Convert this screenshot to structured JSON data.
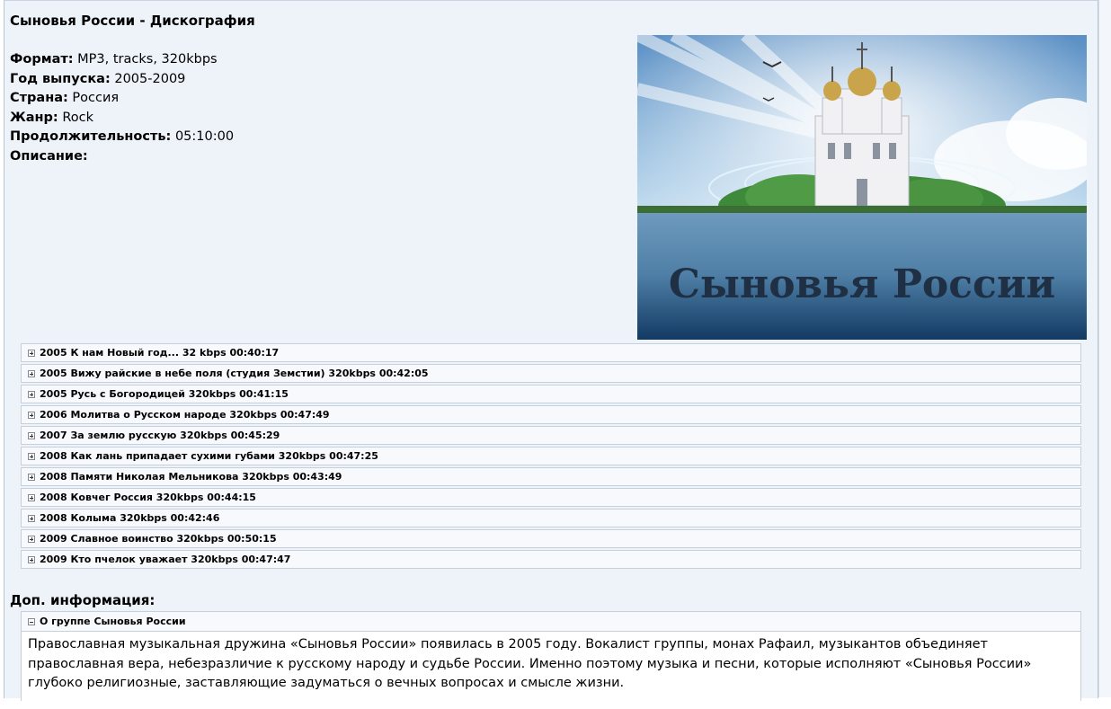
{
  "post": {
    "title": "Сыновья России - Дискография",
    "fields": [
      {
        "label": "Формат:",
        "value": "MP3, tracks, 320kbps"
      },
      {
        "label": "Год выпуска:",
        "value": "2005-2009"
      },
      {
        "label": "Страна:",
        "value": "Россия"
      },
      {
        "label": "Жанр:",
        "value": "Rock"
      },
      {
        "label": "Продолжительность:",
        "value": "05:10:00"
      },
      {
        "label": "Описание:",
        "value": ""
      }
    ],
    "cover_text": "Сыновья России",
    "spoilers": [
      "2005 К нам Новый год... 32 kbps 00:40:17",
      "2005 Вижу райские в небе поля (студия Земстии) 320kbps 00:42:05",
      "2005 Русь с Богородицей 320kbps 00:41:15",
      "2006 Молитва о Русском народе 320kbps 00:47:49",
      "2007 За землю русскую 320kbps 00:45:29",
      "2008 Как лань припадает сухими губами 320kbps 00:47:25",
      "2008 Памяти Николая Мельникова 320kbps 00:43:49",
      "2008 Ковчег Россия 320kbps 00:44:15",
      "2008 Колыма 320kbps 00:42:46",
      "2009 Славное воинство 320kbps 00:50:15",
      "2009 Кто пчелок уважает 320kbps 00:47:47"
    ],
    "dop_title": "Доп. информация:",
    "about": {
      "title": "О группе Сыновья России",
      "text": "Православная музыкальная дружина «Сыновья России» появилась в 2005 году. Вокалист группы, монах Рафаил, музыкантов объединяет православная вера, небезразличие к русскому народу и судьбе России. Именно поэтому музыка и песни, которые исполняют «Сыновья России» глубоко религиозные, заставляющие задуматься о вечных вопросах и смысле жизни."
    }
  }
}
